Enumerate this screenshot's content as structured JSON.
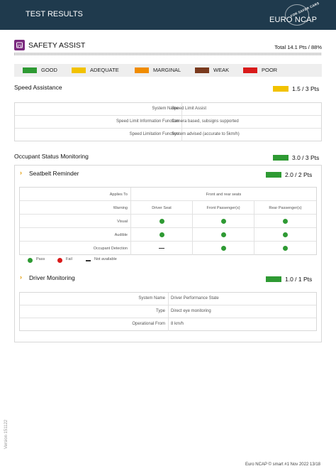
{
  "header": {
    "title": "TEST RESULTS",
    "logo_main": "EURO NCAP",
    "logo_arc": "FOR SAFER CARS"
  },
  "section": {
    "title": "SAFETY ASSIST",
    "total": "Total 14.1 Pts / 88%",
    "icon": "safety-assist-icon"
  },
  "legend": [
    {
      "label": "GOOD",
      "color": "#2e9a33"
    },
    {
      "label": "ADEQUATE",
      "color": "#f2c200"
    },
    {
      "label": "MARGINAL",
      "color": "#f08c00"
    },
    {
      "label": "WEAK",
      "color": "#7a3a1e"
    },
    {
      "label": "POOR",
      "color": "#d91a1a"
    }
  ],
  "speed_assistance": {
    "title": "Speed Assistance",
    "score": "1.5 / 3 Pts",
    "score_color": "#f2c200",
    "rows": [
      {
        "key": "System Name",
        "value": "Speed Limit Assist"
      },
      {
        "key": "Speed Limit Information Function",
        "value": "Camera based, subsigns supported"
      },
      {
        "key": "Speed Limitation Function",
        "value": "System advised (accurate to 5km/h)"
      }
    ]
  },
  "occupant_status": {
    "title": "Occupant Status Monitoring",
    "score": "3.0 / 3 Pts",
    "score_color": "#2e9a33",
    "seatbelt": {
      "title": "Seatbelt Reminder",
      "score": "2.0 / 2 Pts",
      "score_color": "#2e9a33",
      "applies_to_label": "Applies To",
      "applies_to_value": "Front and rear seats",
      "warning_label": "Warning",
      "columns": [
        "Driver Seat",
        "Front Passenger(s)",
        "Rear Passenger(s)"
      ],
      "rows": [
        {
          "label": "Visual",
          "values": [
            "pass",
            "pass",
            "pass"
          ]
        },
        {
          "label": "Audible",
          "values": [
            "pass",
            "pass",
            "pass"
          ]
        },
        {
          "label": "Occupant Detection",
          "values": [
            "na",
            "pass",
            "pass"
          ]
        }
      ],
      "key": {
        "pass": "Pass",
        "fail": "Fail",
        "na": "Not available"
      },
      "pass_color": "#2e9a33",
      "fail_color": "#d91a1a"
    },
    "driver_monitoring": {
      "title": "Driver Monitoring",
      "score": "1.0 / 1 Pts",
      "score_color": "#2e9a33",
      "rows": [
        {
          "key": "System Name",
          "value": "Driver Performance State"
        },
        {
          "key": "Type",
          "value": "Direct eye monitoring"
        },
        {
          "key": "Operational From",
          "value": "8 km/h"
        }
      ]
    }
  },
  "version": "Version 151122",
  "footer": "Euro NCAP © smart #1 Nov 2022 13/18"
}
